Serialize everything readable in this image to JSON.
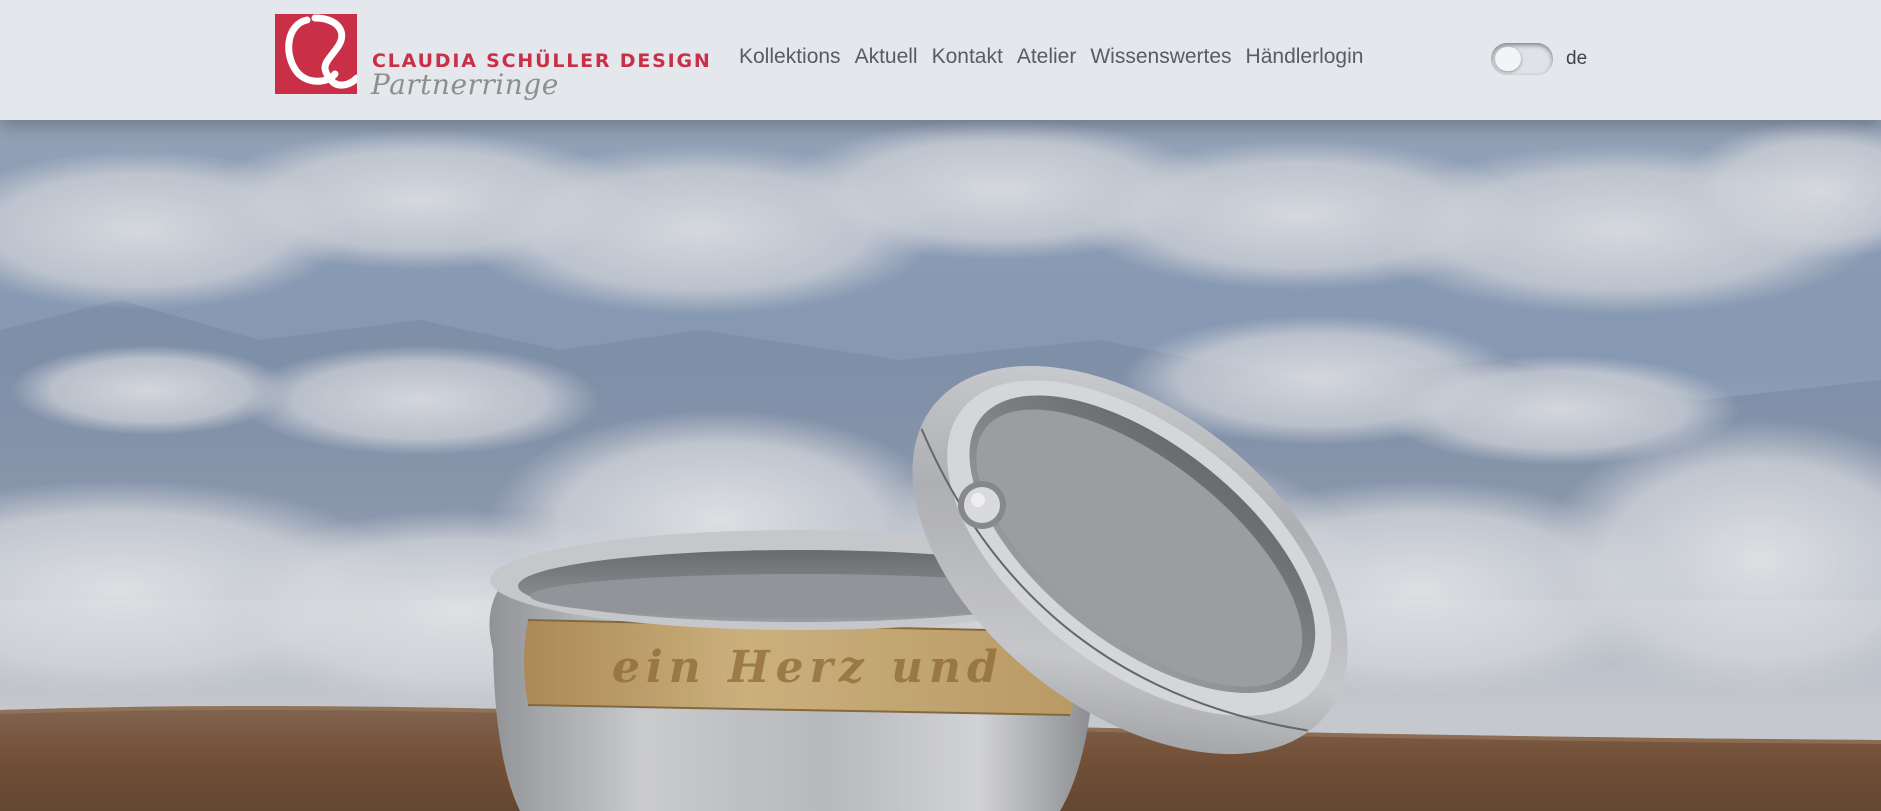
{
  "brand": {
    "name": "CLAUDIA SCHÜLLER DESIGN",
    "subtitle": "Partnerringe",
    "logo_color": "#c93048"
  },
  "nav": {
    "items": [
      {
        "label": "Kollektions"
      },
      {
        "label": "Aktuell"
      },
      {
        "label": "Kontakt"
      },
      {
        "label": "Atelier"
      },
      {
        "label": "Wissenswertes"
      },
      {
        "label": "Händlerlogin"
      }
    ]
  },
  "language": {
    "current": "de",
    "toggle_icon": "toggle-switch"
  },
  "hero": {
    "engraving": "ein Herz und",
    "colors": {
      "sky": "#93a5bf",
      "cloud": "#e6e8ec",
      "ground": "#7a5a40",
      "silver": "#c9cbcd",
      "gold": "#c9a86a"
    }
  }
}
